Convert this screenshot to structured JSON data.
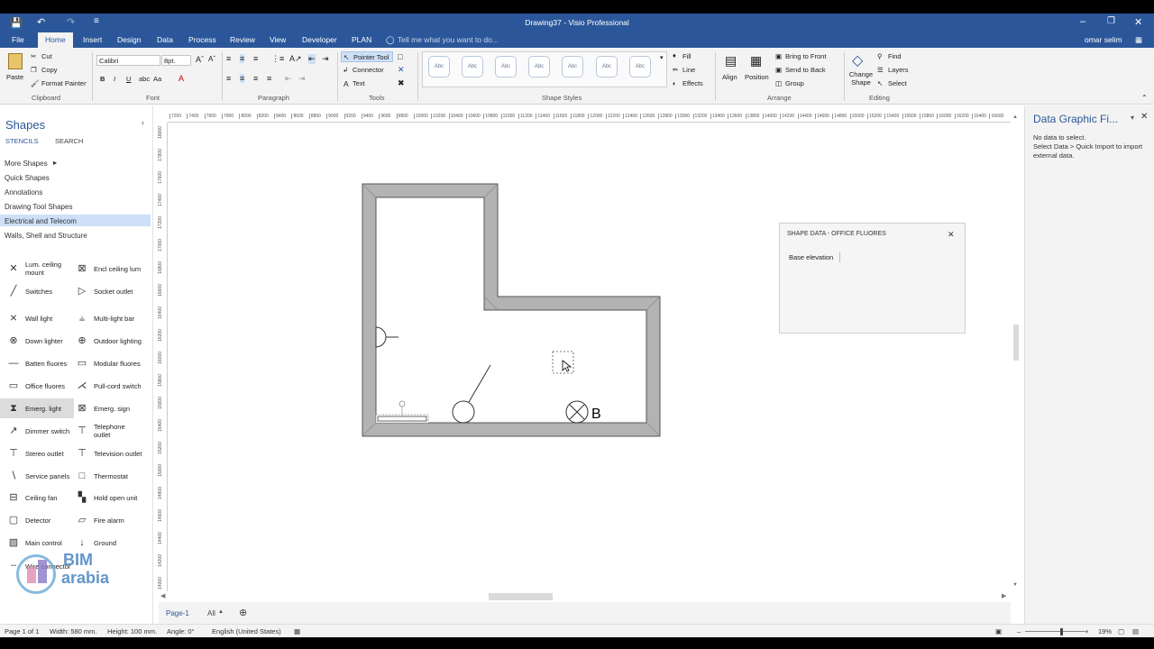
{
  "titlebar": {
    "title": "Drawing37 - Visio Professional"
  },
  "tabs": [
    "File",
    "Home",
    "Insert",
    "Design",
    "Data",
    "Process",
    "Review",
    "View",
    "Developer",
    "PLAN"
  ],
  "tell_me": "Tell me what you want to do...",
  "user": "omar selim",
  "ribbon": {
    "clipboard": {
      "paste": "Paste",
      "cut": "Cut",
      "copy": "Copy",
      "format_painter": "Format Painter",
      "label": "Clipboard"
    },
    "font": {
      "name": "Calibri",
      "size": "8pt.",
      "label": "Font"
    },
    "paragraph": {
      "label": "Paragraph"
    },
    "tools": {
      "pointer": "Pointer Tool",
      "connector": "Connector",
      "text": "Text",
      "label": "Tools"
    },
    "shape_styles": {
      "sample": "Abc",
      "label": "Shape Styles",
      "fill": "Fill",
      "line": "Line",
      "effects": "Effects"
    },
    "arrange": {
      "align": "Align",
      "position": "Position",
      "bring_front": "Bring to Front",
      "send_back": "Send to Back",
      "group": "Group",
      "label": "Arrange"
    },
    "editing": {
      "change_shape": "Change Shape",
      "find": "Find",
      "layers": "Layers",
      "select": "Select",
      "label": "Editing"
    }
  },
  "shapes_pane": {
    "title": "Shapes",
    "tab_stencils": "STENCILS",
    "tab_search": "SEARCH",
    "nav": [
      "More Shapes",
      "Quick Shapes",
      "Annotations",
      "Drawing Tool Shapes",
      "Electrical and Telecom",
      "Walls, Shell and Structure"
    ],
    "selected_nav": "Electrical and Telecom",
    "items": [
      {
        "label": "Lum. ceiling mount",
        "icon": "x-cross-icon"
      },
      {
        "label": "Encl ceiling lum",
        "icon": "boxed-x-icon"
      },
      {
        "label": "Switches",
        "icon": "switch-icon"
      },
      {
        "label": "Socket outlet",
        "icon": "triangle-outlet-icon"
      },
      {
        "label": "Wall light",
        "icon": "wall-light-icon"
      },
      {
        "label": "Multi-light bar",
        "icon": "multi-light-icon"
      },
      {
        "label": "Down lighter",
        "icon": "down-lighter-icon"
      },
      {
        "label": "Outdoor lighting",
        "icon": "outdoor-light-icon"
      },
      {
        "label": "Batten fluores",
        "icon": "batten-icon"
      },
      {
        "label": "Modular fluores",
        "icon": "modular-fluores-icon"
      },
      {
        "label": "Office fluores",
        "icon": "office-fluores-icon"
      },
      {
        "label": "Pull-cord switch",
        "icon": "pull-cord-icon"
      },
      {
        "label": "Emerg. light",
        "icon": "emergency-light-icon"
      },
      {
        "label": "Emerg. sign",
        "icon": "emergency-sign-icon"
      },
      {
        "label": "Dimmer switch",
        "icon": "dimmer-icon"
      },
      {
        "label": "Telephone outlet",
        "icon": "telephone-outlet-icon"
      },
      {
        "label": "Stereo outlet",
        "icon": "stereo-outlet-icon"
      },
      {
        "label": "Television outlet",
        "icon": "tv-outlet-icon"
      },
      {
        "label": "Service panels",
        "icon": "service-panel-icon"
      },
      {
        "label": "Thermostat",
        "icon": "thermostat-icon"
      },
      {
        "label": "Ceiling fan",
        "icon": "ceiling-fan-icon"
      },
      {
        "label": "Hold open unit",
        "icon": "hold-open-icon"
      },
      {
        "label": "Detector",
        "icon": "detector-icon"
      },
      {
        "label": "Fire alarm",
        "icon": "fire-alarm-icon"
      },
      {
        "label": "Main control",
        "icon": "main-control-icon"
      },
      {
        "label": "Ground",
        "icon": "ground-icon"
      },
      {
        "label": "Wire connector",
        "icon": "wire-connector-icon"
      }
    ],
    "selected_item": "Emerg. light"
  },
  "ruler_top": [
    "7200",
    "7400",
    "7600",
    "7800",
    "8000",
    "8200",
    "8400",
    "8600",
    "8800",
    "9000",
    "9200",
    "9400",
    "9600",
    "9800",
    "10000",
    "10200",
    "10400",
    "10600",
    "10800",
    "11000",
    "11200",
    "11400",
    "11600",
    "11800",
    "12000",
    "12200",
    "12400",
    "12600",
    "12800",
    "13000",
    "13200",
    "13400",
    "13600",
    "13800",
    "14000",
    "14200",
    "14400",
    "14600",
    "14800",
    "15000",
    "15200",
    "15400",
    "15600",
    "15800",
    "16000",
    "16200",
    "16400",
    "16600"
  ],
  "ruler_left": [
    "18000",
    "17800",
    "17600",
    "17400",
    "17200",
    "17000",
    "16800",
    "16600",
    "16400",
    "16200",
    "16000",
    "15800",
    "15600",
    "15400",
    "15200",
    "15000",
    "14800",
    "14600",
    "14400",
    "14200",
    "14000"
  ],
  "drawing": {
    "label_b": "B"
  },
  "shape_data": {
    "title": "SHAPE DATA - OFFICE FLUORES",
    "field": "Base elevation"
  },
  "right_pane": {
    "title": "Data Graphic Fi...",
    "line1": "No data to select.",
    "line2": "Select Data > Quick Import to import external data."
  },
  "page_tabs": {
    "page": "Page-1",
    "all": "All"
  },
  "status": {
    "page": "Page 1 of 1",
    "width": "Width: 580 mm.",
    "height": "Height: 100 mm.",
    "angle": "Angle: 0°",
    "language": "English (United States)",
    "zoom": "19%"
  },
  "watermark": {
    "brand_top": "BIM",
    "brand_bottom": "arabia"
  },
  "colors": {
    "accent": "#2b579a",
    "wall": "#b3b3b3",
    "selection": "#cde0f7"
  }
}
